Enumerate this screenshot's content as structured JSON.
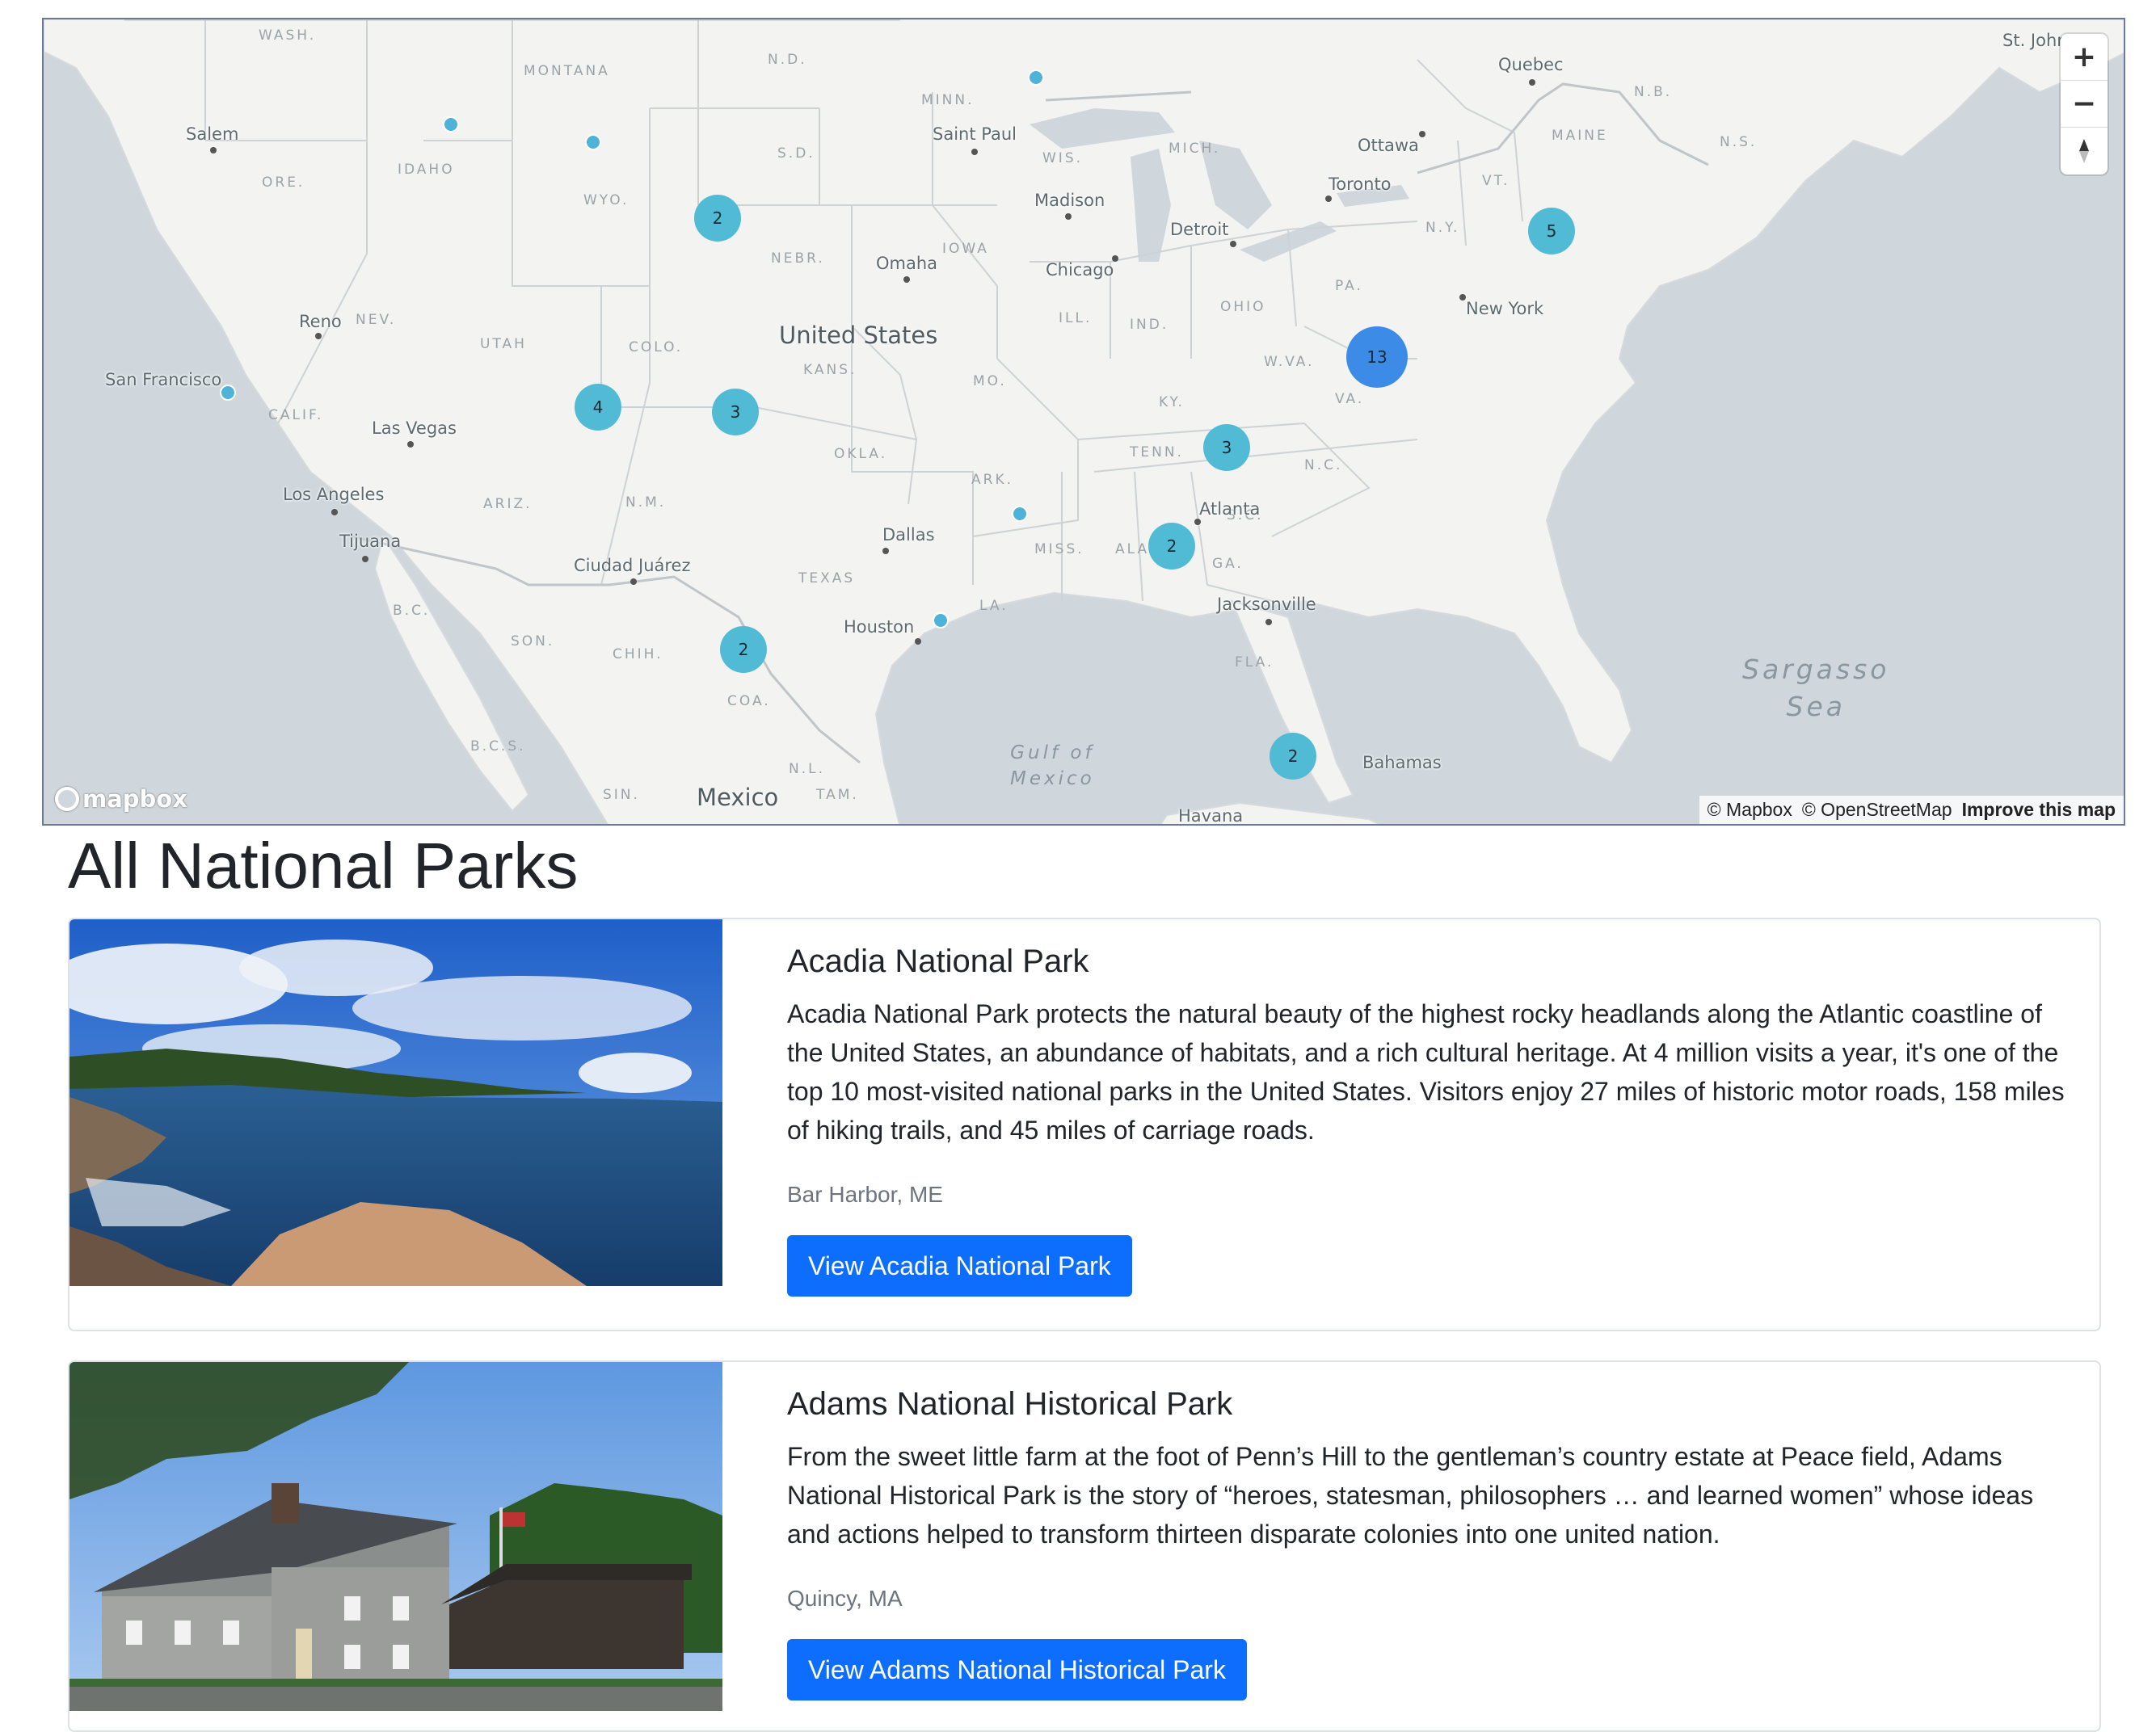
{
  "map": {
    "country_labels": [
      "United States",
      "Mexico"
    ],
    "state_labels": [
      "WASH.",
      "MONTANA",
      "N.D.",
      "MINN.",
      "S.D.",
      "WIS.",
      "MICH.",
      "ORE.",
      "IDAHO",
      "WYO.",
      "NEBR.",
      "IOWA",
      "N.Y.",
      "PA.",
      "VT.",
      "MAINE",
      "N.B.",
      "N.S.",
      "NEV.",
      "UTAH",
      "COLO.",
      "KANS.",
      "MO.",
      "ILL.",
      "IND.",
      "OHIO",
      "W.VA.",
      "VA.",
      "KY.",
      "CALIF.",
      "ARIZ.",
      "N.M.",
      "OKLA.",
      "ARK.",
      "TENN.",
      "N.C.",
      "S.C.",
      "MISS.",
      "ALA.",
      "GA.",
      "TEXAS",
      "LA.",
      "FLA.",
      "SON.",
      "CHIH.",
      "COA.",
      "B.C.",
      "B.C.S.",
      "SIN.",
      "N.L.",
      "TAM."
    ],
    "city_labels": [
      "Salem",
      "Saint Paul",
      "Madison",
      "Quebec",
      "Ottawa",
      "Toronto",
      "Detroit",
      "Chicago",
      "Omaha",
      "New York",
      "Reno",
      "San Francisco",
      "Las Vegas",
      "Los Angeles",
      "Tijuana",
      "Ciudad Juárez",
      "Dallas",
      "Houston",
      "Atlanta",
      "Jacksonville",
      "Bahamas",
      "Havana",
      "St. John"
    ],
    "water_labels": [
      "Gulf of\nMexico",
      "Sargasso\nSea"
    ],
    "clusters": [
      "2",
      "4",
      "3",
      "5",
      "13",
      "3",
      "2",
      "2",
      "2"
    ],
    "zoom_in_label": "+",
    "zoom_out_label": "−",
    "compass_icon": "compass-icon",
    "logo_text": "mapbox",
    "attribution": {
      "mapbox": "© Mapbox",
      "osm": "© OpenStreetMap",
      "improve": "Improve this map"
    },
    "colors": {
      "land": "#f3f3f1",
      "water": "#cfd7dc",
      "cluster_small": "#51bbd6",
      "cluster_large": "#3c8ce7"
    }
  },
  "page_title": "All National Parks",
  "parks": [
    {
      "title": "Acadia National Park",
      "description": "Acadia National Park protects the natural beauty of the highest rocky headlands along the Atlantic coastline of the United States, an abundance of habitats, and a rich cultural heritage. At 4 million visits a year, it's one of the top 10 most-visited national parks in the United States. Visitors enjoy 27 miles of historic motor roads, 158 miles of hiking trails, and 45 miles of carriage roads.",
      "location": "Bar Harbor, ME",
      "button": "View Acadia National Park"
    },
    {
      "title": "Adams National Historical Park",
      "description": "From the sweet little farm at the foot of Penn’s Hill to the gentleman’s country estate at Peace field, Adams National Historical Park is the story of “heroes, statesman, philosophers … and learned women” whose ideas and actions helped to transform thirteen disparate colonies into one united nation.",
      "location": "Quincy, MA",
      "button": "View Adams National Historical Park"
    }
  ],
  "button_color": "#0d6efd"
}
